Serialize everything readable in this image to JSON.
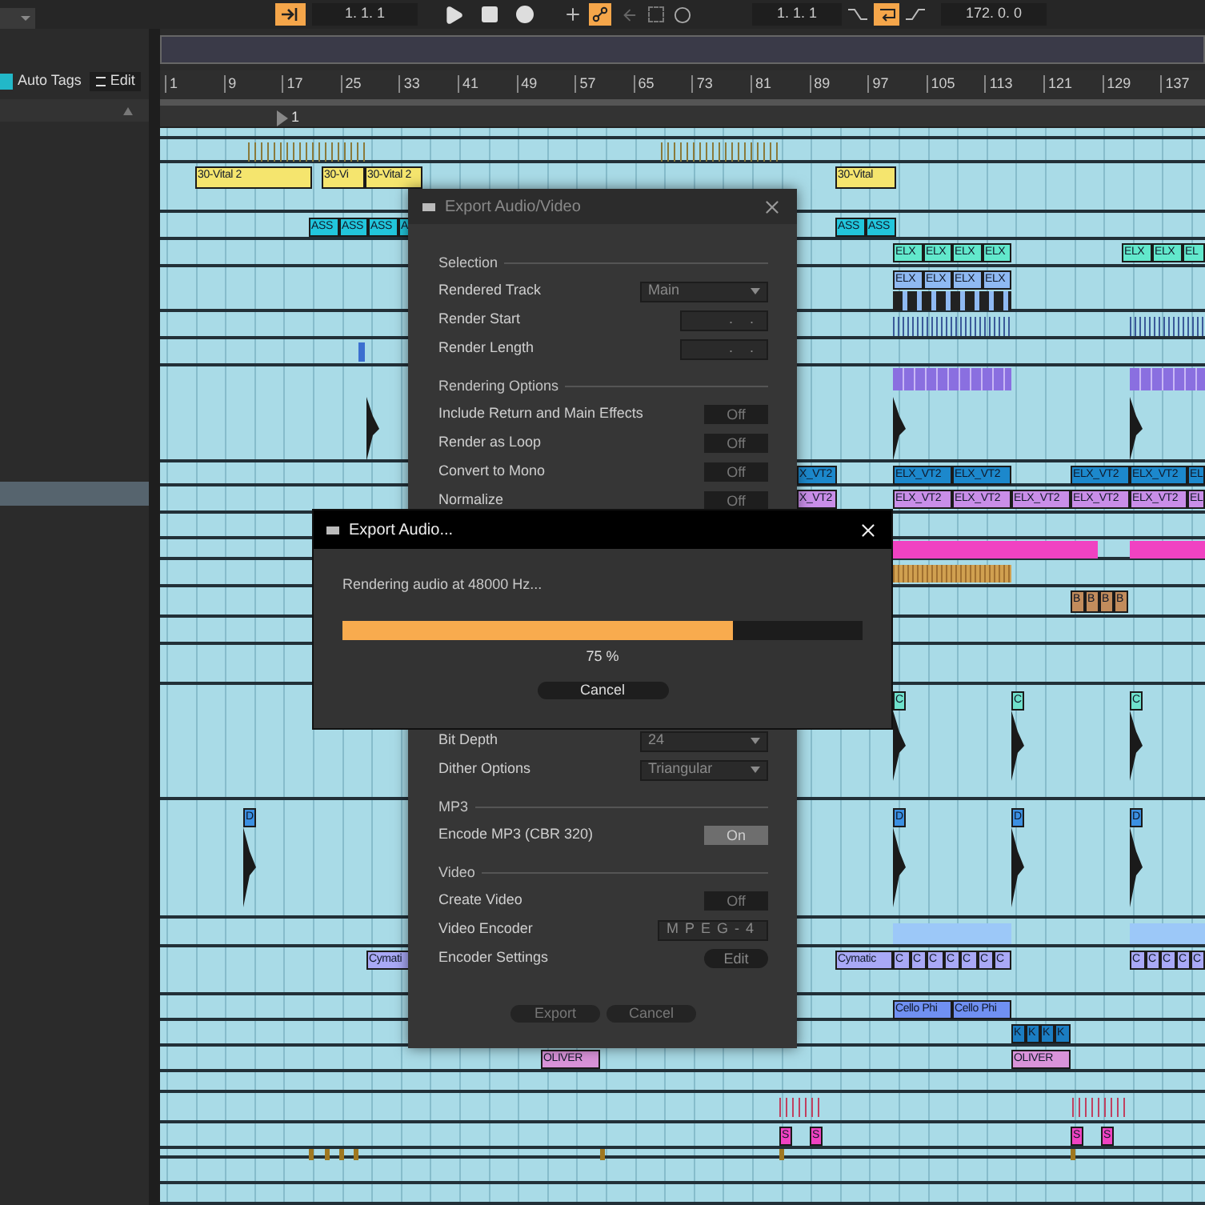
{
  "toolbar": {
    "position": "1. 1. 1",
    "loop_start": "1. 1. 1",
    "loop_length": "172. 0. 0"
  },
  "browser": {
    "auto_tags": "Auto Tags",
    "edit": "Edit"
  },
  "ruler": [
    "1",
    "9",
    "17",
    "25",
    "33",
    "41",
    "49",
    "57",
    "65",
    "73",
    "81",
    "89",
    "97",
    "105",
    "113",
    "121",
    "129",
    "137"
  ],
  "marker": "1",
  "tracks": [
    {
      "color": "#f5e56e",
      "clips": [
        "30-Vital 2",
        "30-Vi",
        "30-Vital 2",
        "30-Vital"
      ]
    },
    {
      "color": "#22c6dc",
      "clips": [
        "ASS",
        "ASS",
        "ASS",
        "A",
        "ASS",
        "ASS"
      ]
    },
    {
      "color": "#62e8cc",
      "clips": [
        "ELX",
        "ELX",
        "ELX",
        "ELX",
        "ELX",
        "ELX",
        "EL"
      ]
    },
    {
      "color": "#8fb9f2",
      "clips": [
        "ELX",
        "ELX",
        "ELX",
        "ELX"
      ]
    },
    {
      "color": "#1c88cc",
      "clips": [
        "X_VT2",
        "ELX_VT2",
        "ELX_VT2",
        "ELX_VT2",
        "ELX_VT2",
        "EL"
      ]
    },
    {
      "color": "#c98ee8",
      "clips": [
        "X_VT2",
        "ELX_VT2",
        "ELX_VT2",
        "ELX_VT2",
        "ELX_VT2",
        "ELX_VT2",
        "EL"
      ]
    },
    {
      "color": "#c28c5c",
      "clips": [
        "B",
        "B",
        "B",
        "B"
      ]
    },
    {
      "color": "#6fe2cc",
      "clips": [
        "C",
        "C",
        "C"
      ]
    },
    {
      "color": "#3b90e2",
      "clips": [
        "D",
        "D",
        "D",
        "D"
      ]
    },
    {
      "color": "#a9a9f6",
      "clips": [
        "Cymati",
        "Cymatic",
        "C",
        "C",
        "C",
        "C",
        "C",
        "C",
        "C",
        "C",
        "C",
        "C",
        "C",
        "C"
      ]
    },
    {
      "color": "#7090f2",
      "clips": [
        "Cello Phi",
        "Cello Phi"
      ]
    },
    {
      "color": "#1b7dc2",
      "clips": [
        "K",
        "K",
        "K",
        "K"
      ]
    },
    {
      "color": "#d993d9",
      "clips": [
        "OLIVER",
        "OLIVER"
      ]
    },
    {
      "color": "#f042c2",
      "clips": [
        "S",
        "S",
        "S",
        "S"
      ]
    }
  ],
  "export_dialog": {
    "title": "Export Audio/Video",
    "sections": [
      {
        "heading": "Selection",
        "rows": [
          {
            "label": "Rendered Track",
            "kind": "dropdown",
            "value": "Main"
          },
          {
            "label": "Render Start",
            "kind": "field",
            "value": ". ."
          },
          {
            "label": "Render Length",
            "kind": "field",
            "value": ". ."
          }
        ]
      },
      {
        "heading": "Rendering Options",
        "rows": [
          {
            "label": "Include Return and Main Effects",
            "kind": "toggle",
            "value": "Off",
            "on": false
          },
          {
            "label": "Render as Loop",
            "kind": "toggle",
            "value": "Off",
            "on": false
          },
          {
            "label": "Convert to Mono",
            "kind": "toggle",
            "value": "Off",
            "on": false
          },
          {
            "label": "Normalize",
            "kind": "toggle",
            "value": "Off",
            "on": false
          }
        ]
      },
      {
        "rows": [
          {
            "label": "Bit Depth",
            "kind": "dropdown",
            "value": "24"
          },
          {
            "label": "Dither Options",
            "kind": "dropdown",
            "value": "Triangular"
          }
        ]
      },
      {
        "heading": "MP3",
        "rows": [
          {
            "label": "Encode MP3 (CBR 320)",
            "kind": "toggle",
            "value": "On",
            "on": true
          }
        ]
      },
      {
        "heading": "Video",
        "rows": [
          {
            "label": "Create Video",
            "kind": "toggle",
            "value": "Off",
            "on": false
          },
          {
            "label": "Video Encoder",
            "kind": "field",
            "value": "MPEG-4"
          },
          {
            "label": "Encoder Settings",
            "kind": "button",
            "value": "Edit"
          }
        ]
      }
    ],
    "buttons": [
      "Export",
      "Cancel"
    ]
  },
  "progress_dialog": {
    "title": "Export Audio...",
    "message": "Rendering audio at 48000 Hz...",
    "level": 0.75,
    "percent": "75 %",
    "button": "Cancel"
  }
}
